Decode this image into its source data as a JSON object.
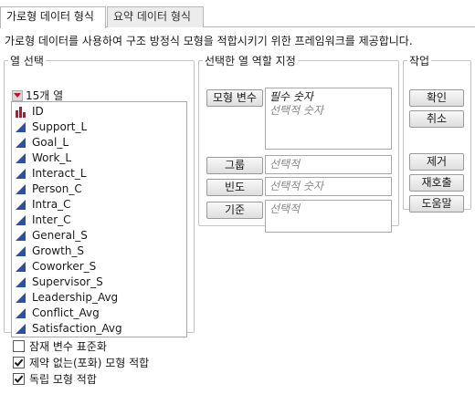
{
  "tabs": [
    {
      "label": "가로형 데이터 형식",
      "active": true
    },
    {
      "label": "요약 데이터 형식",
      "active": false
    }
  ],
  "description": "가로형 데이터를 사용하여 구조 방정식 모형을 적합시키기 위한 프레임워크를 제공합니다.",
  "columns_panel": {
    "legend": "열 선택",
    "count_label": "15개 열",
    "columns": [
      {
        "name": "ID",
        "type": "nominal"
      },
      {
        "name": "Support_L",
        "type": "continuous"
      },
      {
        "name": "Goal_L",
        "type": "continuous"
      },
      {
        "name": "Work_L",
        "type": "continuous"
      },
      {
        "name": "Interact_L",
        "type": "continuous"
      },
      {
        "name": "Person_C",
        "type": "continuous"
      },
      {
        "name": "Intra_C",
        "type": "continuous"
      },
      {
        "name": "Inter_C",
        "type": "continuous"
      },
      {
        "name": "General_S",
        "type": "continuous"
      },
      {
        "name": "Growth_S",
        "type": "continuous"
      },
      {
        "name": "Coworker_S",
        "type": "continuous"
      },
      {
        "name": "Supervisor_S",
        "type": "continuous"
      },
      {
        "name": "Leadership_Avg",
        "type": "continuous"
      },
      {
        "name": "Conflict_Avg",
        "type": "continuous"
      },
      {
        "name": "Satisfaction_Avg",
        "type": "continuous"
      }
    ]
  },
  "roles_panel": {
    "legend": "선택한 열 역할 지정",
    "roles": [
      {
        "button": "모형 변수",
        "required": "필수 숫자",
        "optional": "선택적 숫자"
      },
      {
        "button": "그룹",
        "optional": "선택적"
      },
      {
        "button": "빈도",
        "optional": "선택적 숫자"
      },
      {
        "button": "기준",
        "optional": "선택적"
      }
    ]
  },
  "action_panel": {
    "legend": "작업",
    "ok": "확인",
    "cancel": "취소",
    "remove": "제거",
    "recall": "재호출",
    "help": "도움말"
  },
  "options": [
    {
      "label": "잠재 변수 표준화",
      "checked": false
    },
    {
      "label": "제약 없는(포화) 모형 적합",
      "checked": true
    },
    {
      "label": "독립 모형 적합",
      "checked": true
    }
  ],
  "colors": {
    "continuous_icon": "#2e4fa6",
    "nominal_icon": "#c8102e",
    "dropdown_triangle": "#c8102e"
  }
}
